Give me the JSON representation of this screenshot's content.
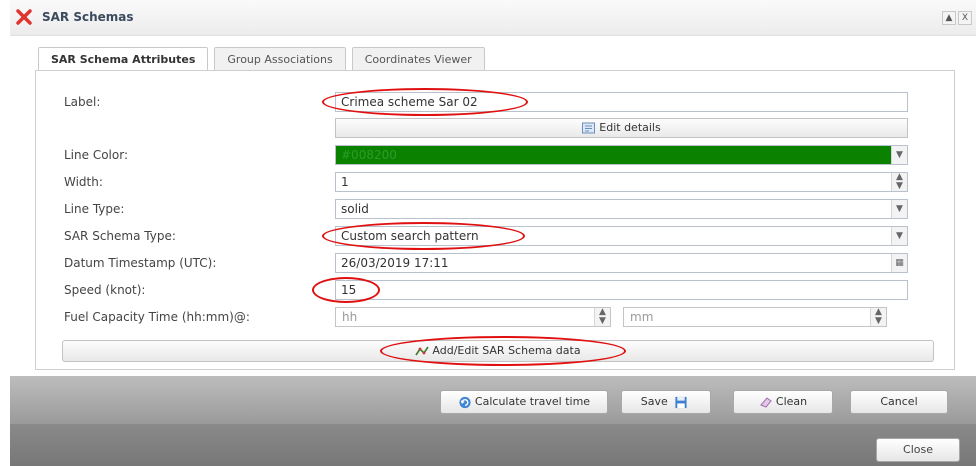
{
  "window": {
    "title": "SAR Schemas",
    "controls": [
      "▲",
      "X"
    ]
  },
  "tabs": [
    {
      "label": "SAR Schema Attributes",
      "active": true
    },
    {
      "label": "Group Associations",
      "active": false
    },
    {
      "label": "Coordinates Viewer",
      "active": false
    }
  ],
  "form": {
    "label": {
      "label": "Label:",
      "value": "Crimea scheme Sar 02"
    },
    "edit_details": "Edit details",
    "line_color": {
      "label": "Line Color:",
      "value": "#008200",
      "color": "#008200"
    },
    "width": {
      "label": "Width:",
      "value": "1"
    },
    "line_type": {
      "label": "Line Type:",
      "value": "solid"
    },
    "sar_schema_type": {
      "label": "SAR Schema Type:",
      "value": "Custom search pattern"
    },
    "datum_timestamp": {
      "label": "Datum Timestamp (UTC):",
      "value": "26/03/2019 17:11"
    },
    "speed": {
      "label": "Speed (knot):",
      "value": "15"
    },
    "fuel_capacity": {
      "label": "Fuel Capacity Time (hh:mm)@:",
      "hh_placeholder": "hh",
      "mm_placeholder": "mm"
    },
    "add_edit": "Add/Edit SAR Schema data"
  },
  "footer": {
    "calculate": "Calculate travel time",
    "save": "Save",
    "clean": "Clean",
    "cancel": "Cancel",
    "close": "Close"
  }
}
